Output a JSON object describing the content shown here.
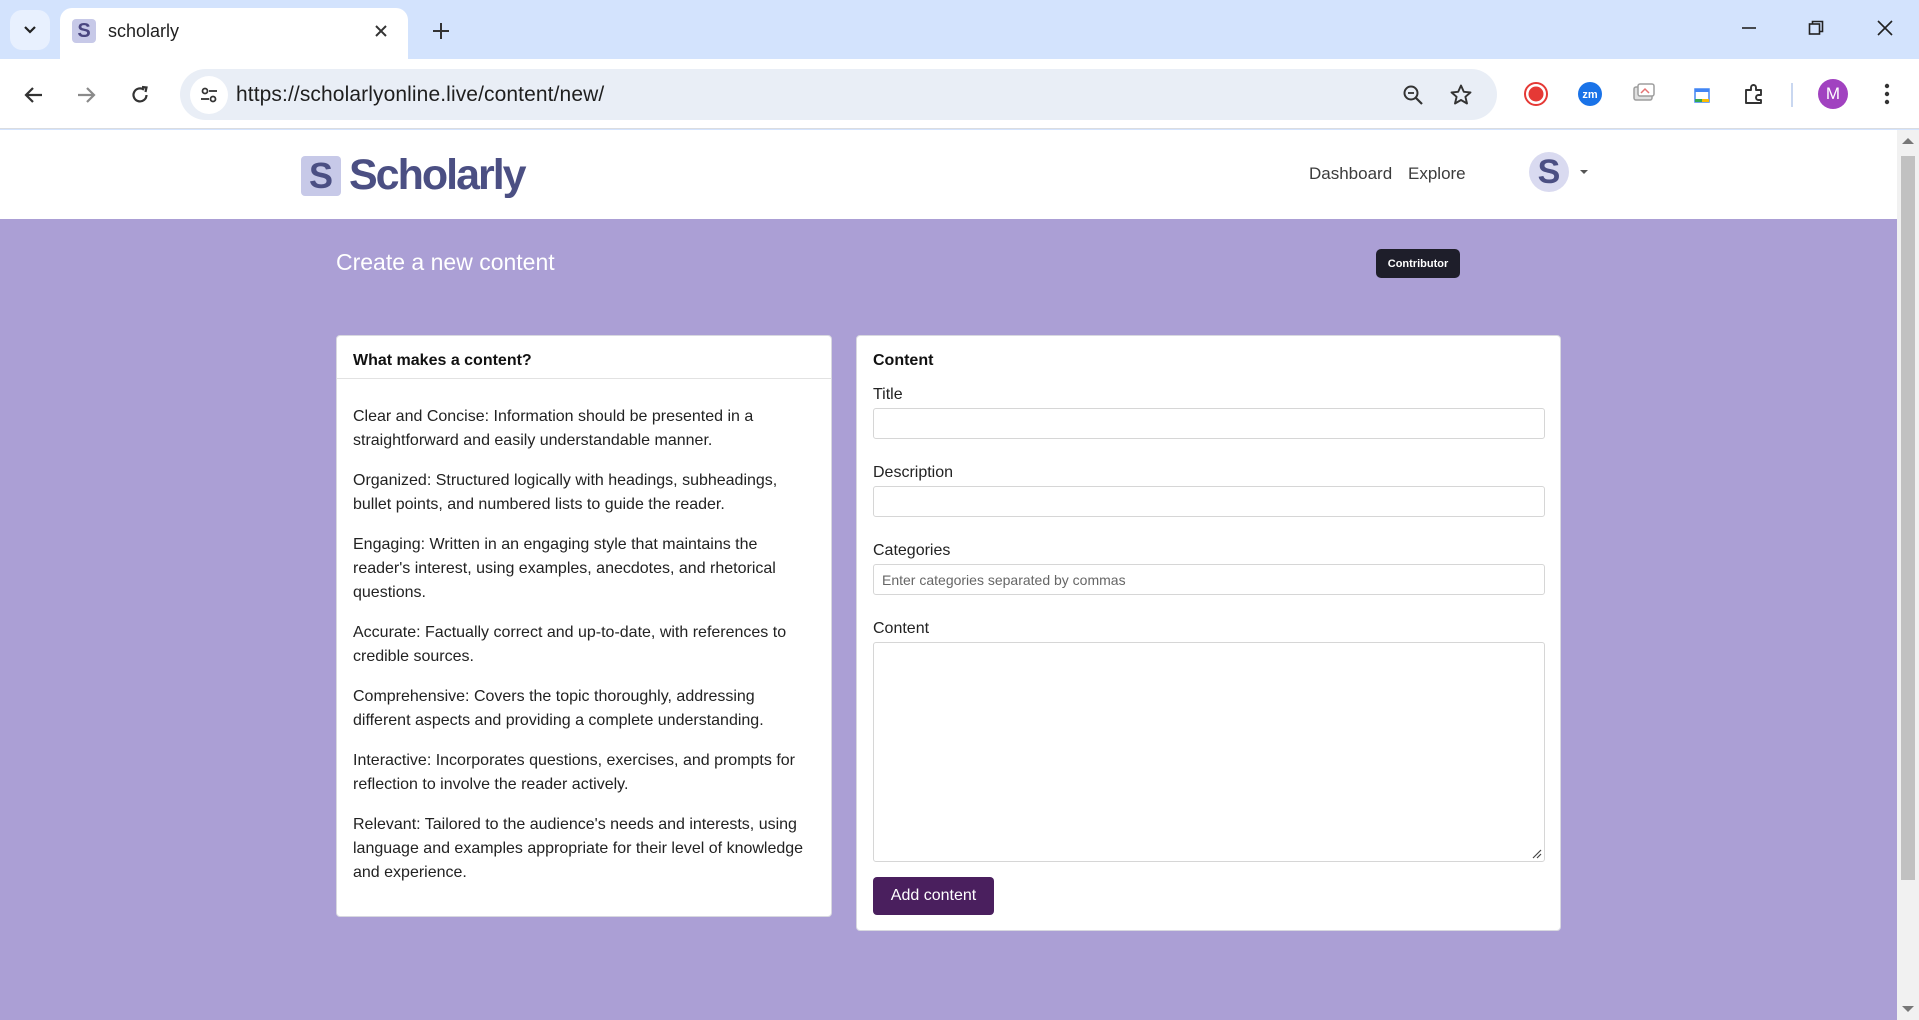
{
  "browser": {
    "tab_title": "scholarly",
    "tab_favicon_letter": "S",
    "url": "https://scholarlyonline.live/content/new/",
    "profile_initial": "M"
  },
  "site": {
    "logo_letter": "S",
    "logo_text": "Scholarly",
    "nav": {
      "dashboard": "Dashboard",
      "explore": "Explore"
    },
    "avatar_letter": "S"
  },
  "page": {
    "heading": "Create a new content",
    "role_badge": "Contributor"
  },
  "info_card": {
    "title": "What makes a content?",
    "items": [
      "Clear and Concise: Information should be presented in a straightforward and easily understandable manner.",
      "Organized: Structured logically with headings, subheadings, bullet points, and numbered lists to guide the reader.",
      "Engaging: Written in an engaging style that maintains the reader's interest, using examples, anecdotes, and rhetorical questions.",
      "Accurate: Factually correct and up-to-date, with references to credible sources.",
      "Comprehensive: Covers the topic thoroughly, addressing different aspects and providing a complete understanding.",
      "Interactive: Incorporates questions, exercises, and prompts for reflection to involve the reader actively.",
      "Relevant: Tailored to the audience's needs and interests, using language and examples appropriate for their level of knowledge and experience."
    ]
  },
  "form": {
    "title": "Content",
    "title_label": "Title",
    "title_value": "",
    "description_label": "Description",
    "description_value": "",
    "categories_label": "Categories",
    "categories_placeholder": "Enter categories separated by commas",
    "content_label": "Content",
    "content_value": "",
    "submit_label": "Add content"
  }
}
